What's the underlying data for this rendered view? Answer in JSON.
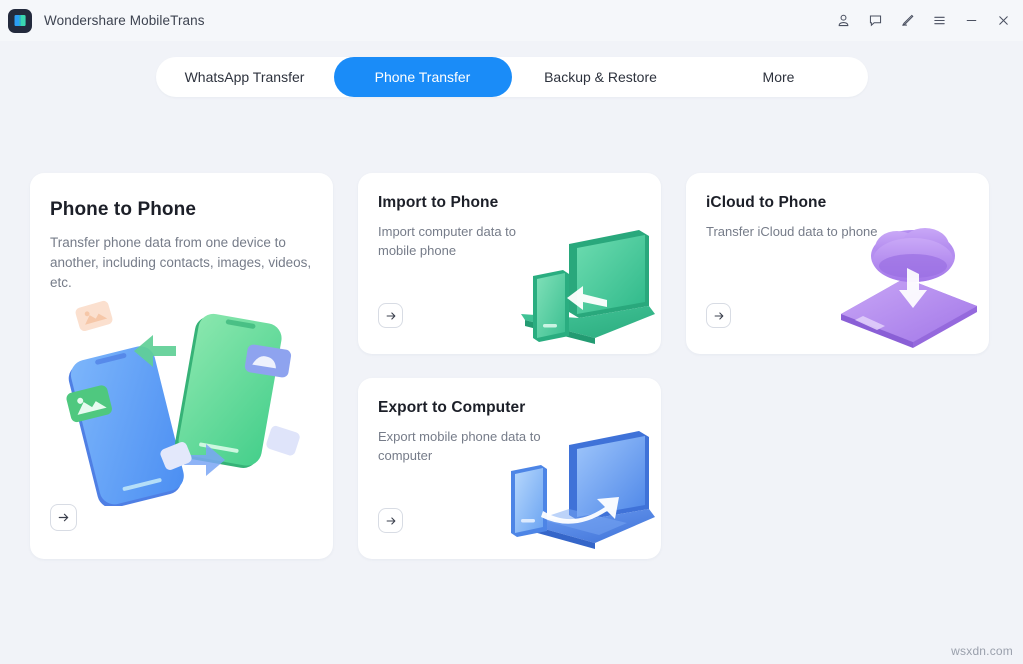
{
  "window": {
    "title": "Wondershare MobileTrans",
    "app_icon": "app-logo-icon",
    "controls": [
      {
        "name": "account-icon",
        "label": "Account"
      },
      {
        "name": "feedback-icon",
        "label": "Feedback"
      },
      {
        "name": "edit-icon",
        "label": "Edit"
      },
      {
        "name": "menu-icon",
        "label": "Menu"
      },
      {
        "name": "minimize-icon",
        "label": "Minimize"
      },
      {
        "name": "close-icon",
        "label": "Close"
      }
    ]
  },
  "tabs": {
    "active_index": 1,
    "active_color": "#1a8cf8",
    "items": [
      {
        "label": "WhatsApp Transfer"
      },
      {
        "label": "Phone Transfer"
      },
      {
        "label": "Backup & Restore"
      },
      {
        "label": "More"
      }
    ]
  },
  "cards": [
    {
      "title": "Phone to Phone",
      "description": "Transfer phone data from one device to another, including contacts, images, videos, etc.",
      "illustration": "two-phones-transfer-illustration",
      "action_label": "→",
      "accent": "#5bd39a"
    },
    {
      "title": "Import to Phone",
      "description": "Import computer data to mobile phone",
      "illustration": "laptop-to-phone-green-illustration",
      "action_label": "→",
      "accent": "#38c793"
    },
    {
      "title": "iCloud to Phone",
      "description": "Transfer iCloud data to phone",
      "illustration": "cloud-to-phone-purple-illustration",
      "action_label": "→",
      "accent": "#ae85ee"
    },
    {
      "title": "Export to Computer",
      "description": "Export mobile phone data to computer",
      "illustration": "phone-to-laptop-blue-illustration",
      "action_label": "→",
      "accent": "#4f8ef0"
    }
  ],
  "watermark": "wsxdn.com"
}
